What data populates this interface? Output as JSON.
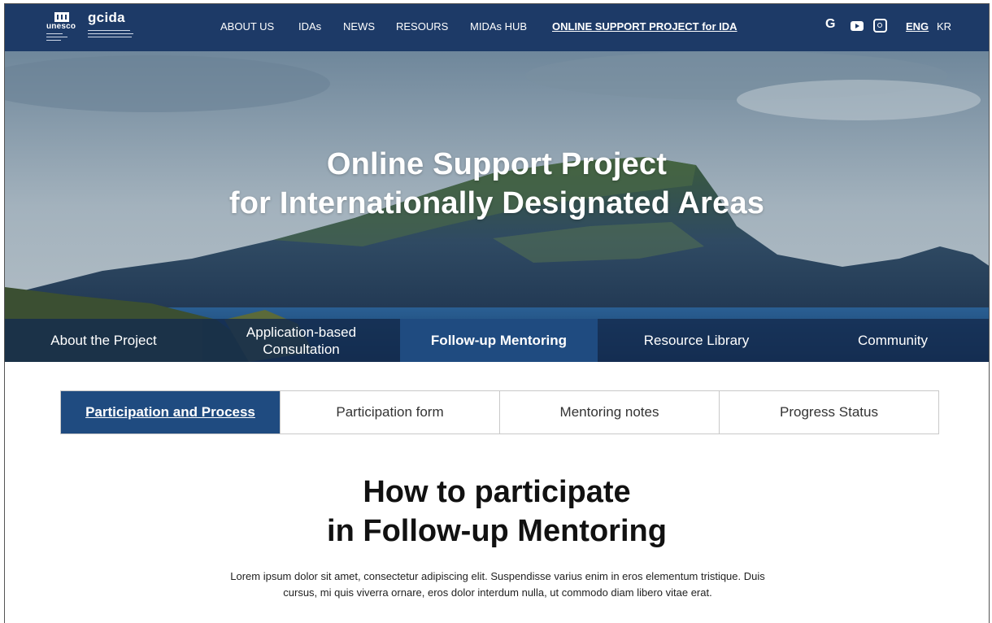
{
  "brand": {
    "unesco_text": "unesco",
    "gcida_text": "gcida"
  },
  "topnav": {
    "items": [
      "ABOUT US",
      "IDAs",
      "NEWS",
      "RESOURS",
      "MIDAs HUB",
      "ONLINE SUPPORT PROJECT for IDA"
    ],
    "social": [
      "G"
    ],
    "lang_eng": "ENG",
    "lang_kr": "KR"
  },
  "hero": {
    "title_line1": "Online Support Project",
    "title_line2": "for Internationally Designated Areas"
  },
  "hero_tabs": [
    {
      "label": "About the Project"
    },
    {
      "label_line1": "Application-based",
      "label_line2": "Consultation"
    },
    {
      "label": "Follow-up Mentoring"
    },
    {
      "label": "Resource Library"
    },
    {
      "label": "Community"
    }
  ],
  "subtabs": [
    "Participation and Process",
    "Participation form",
    "Mentoring notes",
    "Progress Status"
  ],
  "content": {
    "heading_line1": "How to participate",
    "heading_line2": "in Follow-up Mentoring",
    "body": "Lorem ipsum dolor sit amet, consectetur adipiscing elit. Suspendisse varius enim in eros elementum tristique. Duis cursus, mi quis viverra ornare, eros dolor interdum nulla, ut commodo diam libero vitae erat."
  },
  "colors": {
    "header_bg": "#1d3a67",
    "active_tab": "#1f4b80",
    "hero_tab_bg": "#142b4d"
  }
}
